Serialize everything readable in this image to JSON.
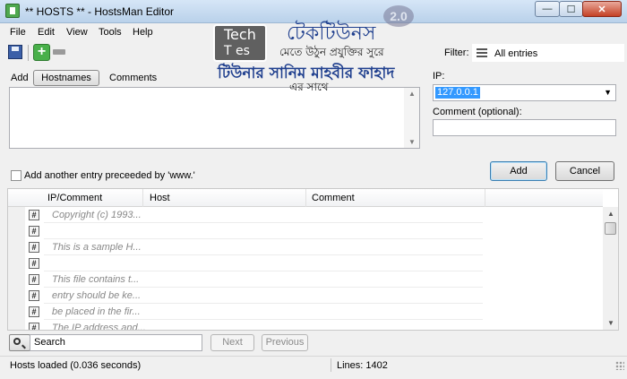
{
  "window": {
    "title": "** HOSTS ** - HostsMan Editor",
    "min_glyph": "—",
    "max_glyph": "☐",
    "close_glyph": "✕"
  },
  "menu": [
    "File",
    "Edit",
    "View",
    "Tools",
    "Help"
  ],
  "toolbar": {
    "add_glyph": "+",
    "filter_label": "Filter:",
    "filter_value": "All entries"
  },
  "add_panel": {
    "add_label": "Add",
    "hostnames_tab": "Hostnames",
    "comments_tab": "Comments",
    "www_label": "Add another entry preceeded by 'www.'",
    "ip_label": "IP:",
    "ip_value": "127.0.0.1",
    "comment_label": "Comment (optional):",
    "add_button": "Add",
    "cancel_button": "Cancel"
  },
  "list": {
    "columns": [
      "IP/Comment",
      "Host",
      "Comment"
    ],
    "hash_glyph": "#",
    "rows": [
      "Copyright (c) 1993...",
      "",
      "This is a sample H...",
      "",
      "This file contains t...",
      "entry should be ke...",
      "be placed in the fir...",
      "The IP address and..."
    ]
  },
  "search": {
    "placeholder": "Search",
    "next_button": "Next",
    "previous_button": "Previous"
  },
  "status": {
    "left": "Hosts loaded (0.036 seconds)",
    "right": "Lines: 1402"
  },
  "watermark": {
    "logo_top": "Tech",
    "logo_bottom": "T  es",
    "badge": "2.0",
    "line1": "টেকটিউনস",
    "line2": "মেতে উঠুন প্রযুক্তির সুরে",
    "line3": "টিউনার সানিম মাহবীর ফাহাদ",
    "line4": "এর সাথে"
  }
}
